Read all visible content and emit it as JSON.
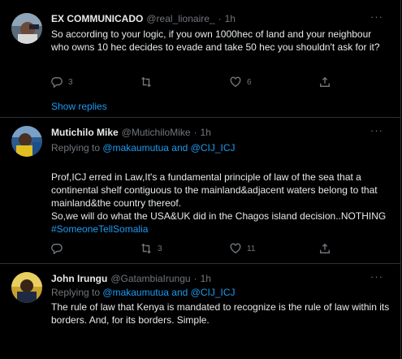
{
  "tweets": [
    {
      "name": "EX COMMUNICADO",
      "handle": "@real_lionaire_",
      "dot": "·",
      "time": "1h",
      "more": "···",
      "text": "So according to your logic, if you own 1000hec of land and your neighbour who owns 10 hec decides to evade and take 50 hec you shouldn't ask for it?",
      "reply_count": "3",
      "retweet_count": "",
      "like_count": "6",
      "show_replies": "Show replies"
    },
    {
      "name": "Mutichilo Mike",
      "handle": "@MutichiloMike",
      "dot": "·",
      "time": "1h",
      "more": "···",
      "replying_prefix": "Replying to",
      "replying_mentions": "@makaumutua and @CIJ_ICJ",
      "text": "Prof,ICJ erred in Law,It's a fundamental principle of law of the sea that a continental shelf contiguous to the mainland&adjacent waters  belong to that mainland&the country thereof.\nSo,we will do what the USA&UK did in the Chagos island decision..NOTHING",
      "hashtag": "#SomeoneTellSomalia",
      "reply_count": "",
      "retweet_count": "3",
      "like_count": "11"
    },
    {
      "name": "John Irungu",
      "handle": "@GatambiaIrungu",
      "dot": "·",
      "time": "1h",
      "more": "···",
      "replying_prefix": "Replying to",
      "replying_mentions": "@makaumutua and @CIJ_ICJ",
      "text": "The rule of law that Kenya is mandated to recognize is the rule of law within its borders. And, for its borders. Simple."
    }
  ],
  "icons": [
    "reply-icon",
    "retweet-icon",
    "like-icon",
    "share-icon",
    "more-icon"
  ]
}
